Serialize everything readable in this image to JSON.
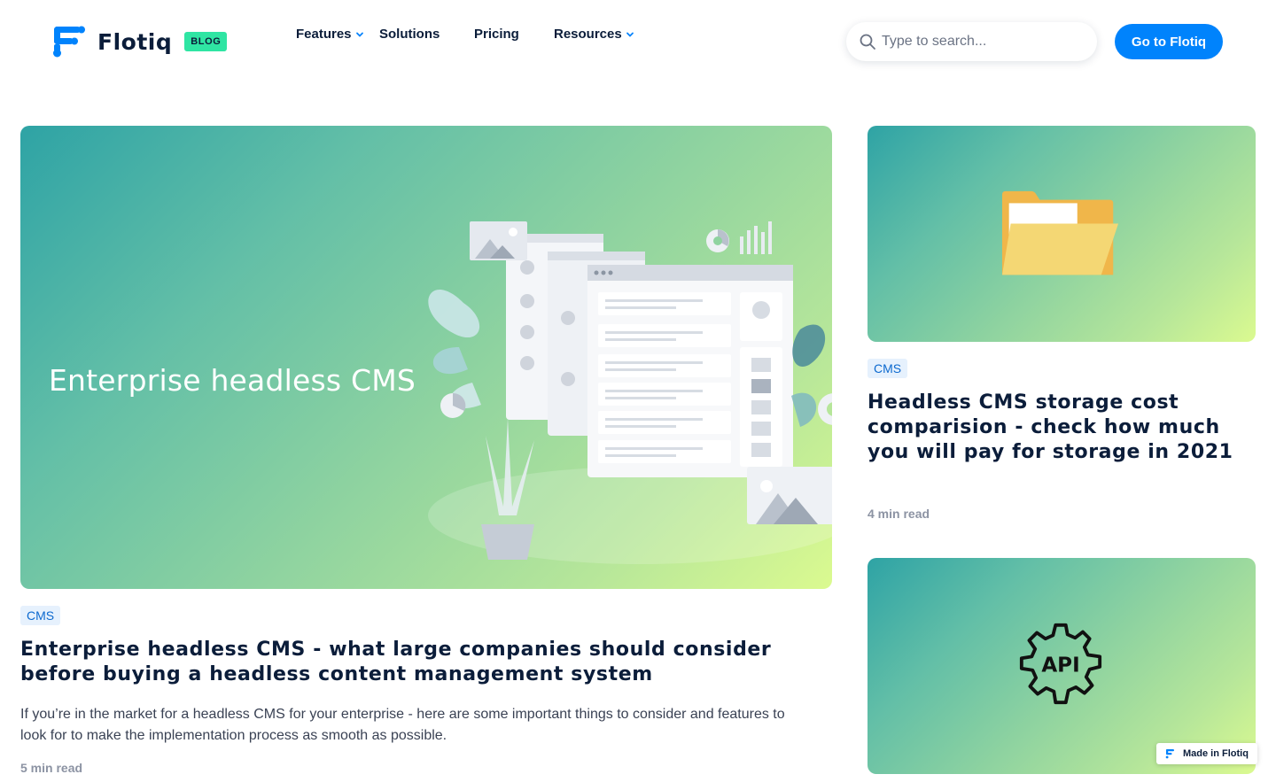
{
  "header": {
    "logo_text": "Flotiq",
    "badge": "BLOG",
    "nav": [
      {
        "label": "Features",
        "has_dropdown": true
      },
      {
        "label": "Solutions",
        "has_dropdown": false
      },
      {
        "label": "Pricing",
        "has_dropdown": false
      },
      {
        "label": "Resources",
        "has_dropdown": true
      }
    ],
    "search_placeholder": "Type to search...",
    "cta_label": "Go to Flotiq"
  },
  "main_post": {
    "image_text": "Enterprise headless CMS",
    "tag": "CMS",
    "title": "Enterprise headless CMS - what large companies should consider before buying a headless content management system",
    "excerpt": "If you’re in the market for a headless CMS for your enterprise - here are some important things to consider and features to look for to make the implementation process as smooth as possible.",
    "read_time": "5 min read"
  },
  "side_posts": [
    {
      "image_icon": "folder-icon",
      "tag": "CMS",
      "title": "Headless CMS storage cost comparision - check how much you will pay for storage in 2021",
      "read_time": "4 min read"
    },
    {
      "image_icon": "api-gear-icon",
      "image_text": "API"
    }
  ],
  "made_in": {
    "label": "Made in Flotiq"
  },
  "colors": {
    "brand_blue": "#0083fc",
    "badge_green": "#2fe5a3",
    "navy_text": "#0b1d3a",
    "tag_bg": "#e6f1fd",
    "tag_text": "#0c69cf"
  }
}
